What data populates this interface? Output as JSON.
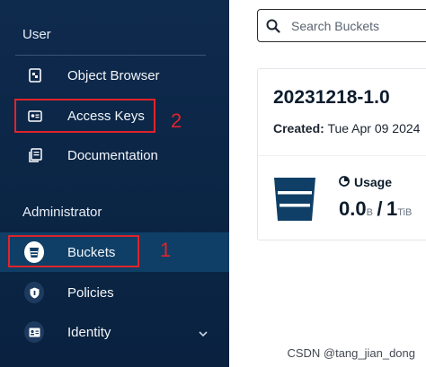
{
  "sidebar": {
    "section_user": "User",
    "section_admin": "Administrator",
    "items": [
      {
        "label": "Object Browser",
        "icon": "object-browser-icon"
      },
      {
        "label": "Access Keys",
        "icon": "access-keys-icon"
      },
      {
        "label": "Documentation",
        "icon": "documentation-icon"
      },
      {
        "label": "Buckets",
        "icon": "bucket-icon",
        "active": true
      },
      {
        "label": "Policies",
        "icon": "shield-icon"
      },
      {
        "label": "Identity",
        "icon": "identity-icon"
      }
    ]
  },
  "annotations": {
    "first": "1",
    "second": "2"
  },
  "main": {
    "search_placeholder": "Search Buckets",
    "card": {
      "title": "20231218-1.0",
      "created_label": "Created:",
      "created_value": "Tue Apr 09 2024",
      "usage_label": "Usage",
      "usage_value": "0.0",
      "usage_unit": "B",
      "usage_separator": "/",
      "quota_value": "1",
      "quota_unit": "TiB"
    }
  },
  "watermark": "CSDN @tang_jian_dong",
  "colors": {
    "sidebar_bg": "#0b2545",
    "active_bg": "#0f3f66",
    "annotation": "#e0232a",
    "text_dark": "#0c1c2c"
  }
}
